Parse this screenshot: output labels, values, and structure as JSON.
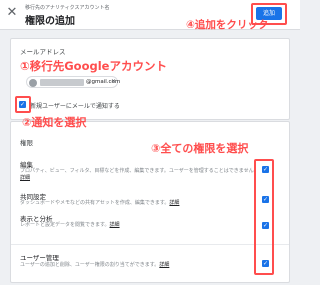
{
  "header": {
    "breadcrumb": "移行先のアナリティクスアカウント名",
    "title": "権限の追加",
    "close_glyph": "✕",
    "add_label": "追加"
  },
  "email_section": {
    "label": "メールアドレス",
    "chip_text": "@gmail.com",
    "chip_close": "✕"
  },
  "notify": {
    "label": "新規ユーザーにメールで通知する",
    "checked": true
  },
  "permissions": {
    "heading": "権限",
    "items": [
      {
        "title": "編集",
        "desc": "プロパティ、ビュー、フィルタ、目標などを作成、編集できます。ユーザーを管理することはできません。",
        "link": "詳細",
        "checked": true
      },
      {
        "title": "共同設定",
        "desc": "ダッシュボードやメモなどの共有アセットを作成、編集できます。",
        "link": "詳細",
        "checked": true
      },
      {
        "title": "表示と分析",
        "desc": "レポートと設定データを閲覧できます。",
        "link": "詳細",
        "checked": true
      },
      {
        "title": "ユーザー管理",
        "desc": "ユーザーの追加と削除、ユーザー権限の割り当てができます。",
        "link": "詳細",
        "checked": true
      }
    ]
  },
  "annotations": {
    "add": "④追加をクリック",
    "account": "①移行先Googleアカウント",
    "notify": "②通知を選択",
    "permissions": "③全ての権限を選択"
  },
  "colors": {
    "accent": "#1a73e8",
    "annotation": "#ff4d4d"
  },
  "icons": {
    "close": "close-icon",
    "check": "check-icon"
  }
}
